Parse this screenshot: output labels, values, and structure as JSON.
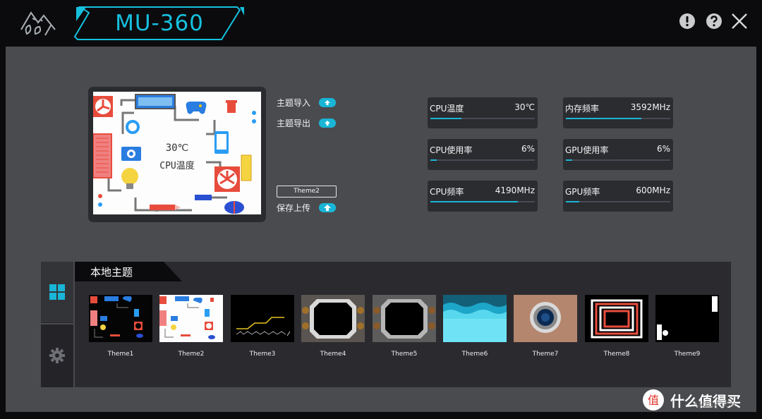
{
  "app": {
    "title": "MU-360"
  },
  "preview": {
    "temp_value": "30℃",
    "temp_label": "CPU温度"
  },
  "actions": {
    "import_label": "主题导入",
    "export_label": "主题导出",
    "theme_name": "Theme2",
    "save_upload_label": "保存上传"
  },
  "stats": [
    {
      "label": "CPU温度",
      "value": "30℃",
      "level": 0.3
    },
    {
      "label": "内存频率",
      "value": "3592MHz",
      "level": 0.72
    },
    {
      "label": "CPU使用率",
      "value": "6%",
      "level": 0.06
    },
    {
      "label": "GPU使用率",
      "value": "6%",
      "level": 0.06
    },
    {
      "label": "CPU频率",
      "value": "4190MHz",
      "level": 0.84
    },
    {
      "label": "GPU频率",
      "value": "600MHz",
      "level": 0.13
    }
  ],
  "library": {
    "header": "本地主题",
    "tabs": [
      "themes-grid",
      "settings"
    ],
    "themes": [
      {
        "name": "Theme1"
      },
      {
        "name": "Theme2"
      },
      {
        "name": "Theme3"
      },
      {
        "name": "Theme4"
      },
      {
        "name": "Theme5"
      },
      {
        "name": "Theme6"
      },
      {
        "name": "Theme7"
      },
      {
        "name": "Theme8"
      },
      {
        "name": "Theme9"
      }
    ]
  },
  "watermark": {
    "text": "什么值得买",
    "sub": "SMZDM.COM"
  },
  "colors": {
    "accent": "#16c0de",
    "panel": "#4a4b4f",
    "dark": "#0b0b0d"
  },
  "icons": [
    "app-logo-icon",
    "info-icon",
    "help-icon",
    "close-icon",
    "upload-icon",
    "grid-icon",
    "gear-icon"
  ]
}
